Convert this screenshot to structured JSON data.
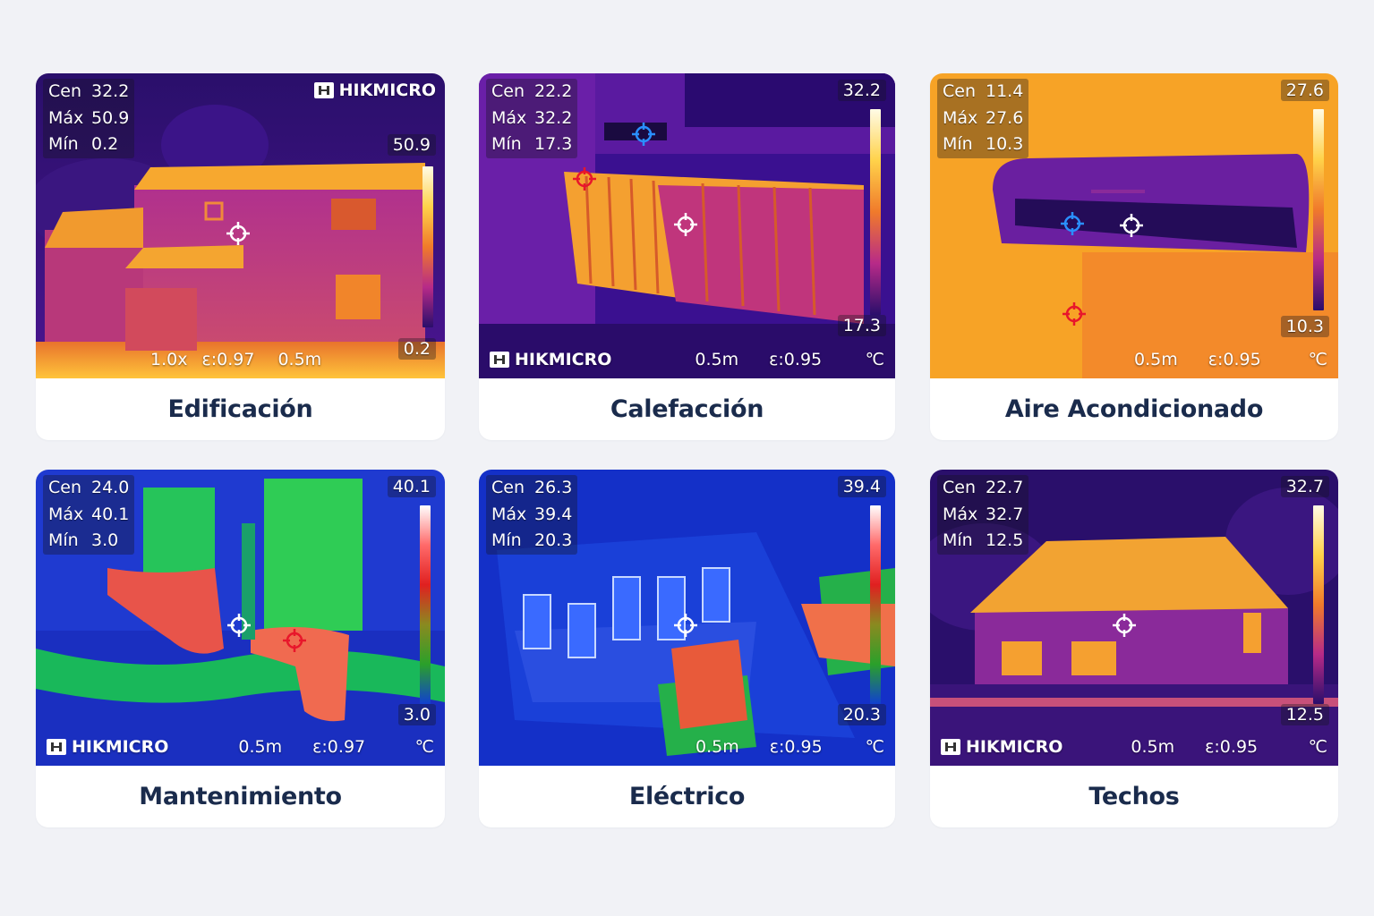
{
  "brand": "HIKMICRO",
  "cards": [
    {
      "caption": "Edificación",
      "readout": {
        "cen_label": "Cen",
        "cen": "32.2",
        "max_label": "Máx",
        "max": "50.9",
        "min_label": "Mín",
        "min": "0.2"
      },
      "scale_max": "50.9",
      "scale_min": "0.2",
      "zoom": "1.0x",
      "emissivity": "ε:0.97",
      "distance": "0.5m",
      "unit": ""
    },
    {
      "caption": "Calefacción",
      "readout": {
        "cen_label": "Cen",
        "cen": "22.2",
        "max_label": "Máx",
        "max": "32.2",
        "min_label": "Mín",
        "min": "17.3"
      },
      "scale_max": "32.2",
      "scale_min": "17.3",
      "distance": "0.5m",
      "emissivity": "ε:0.95",
      "unit": "℃"
    },
    {
      "caption": "Aire Acondicionado",
      "readout": {
        "cen_label": "Cen",
        "cen": "11.4",
        "max_label": "Máx",
        "max": "27.6",
        "min_label": "Mín",
        "min": "10.3"
      },
      "scale_max": "27.6",
      "scale_min": "10.3",
      "distance": "0.5m",
      "emissivity": "ε:0.95",
      "unit": "℃"
    },
    {
      "caption": "Mantenimiento",
      "readout": {
        "cen_label": "Cen",
        "cen": "24.0",
        "max_label": "Máx",
        "max": "40.1",
        "min_label": "Mín",
        "min": "3.0"
      },
      "scale_max": "40.1",
      "scale_min": "3.0",
      "distance": "0.5m",
      "emissivity": "ε:0.97",
      "unit": "℃"
    },
    {
      "caption": "Eléctrico",
      "readout": {
        "cen_label": "Cen",
        "cen": "26.3",
        "max_label": "Máx",
        "max": "39.4",
        "min_label": "Mín",
        "min": "20.3"
      },
      "scale_max": "39.4",
      "scale_min": "20.3",
      "distance": "0.5m",
      "emissivity": "ε:0.95",
      "unit": "℃"
    },
    {
      "caption": "Techos",
      "readout": {
        "cen_label": "Cen",
        "cen": "22.7",
        "max_label": "Máx",
        "max": "32.7",
        "min_label": "Mín",
        "min": "12.5"
      },
      "scale_max": "32.7",
      "scale_min": "12.5",
      "distance": "0.5m",
      "emissivity": "ε:0.95",
      "unit": "℃"
    }
  ],
  "colors": {
    "page_bg": "#f1f2f6",
    "caption_text": "#1a2b4c"
  }
}
